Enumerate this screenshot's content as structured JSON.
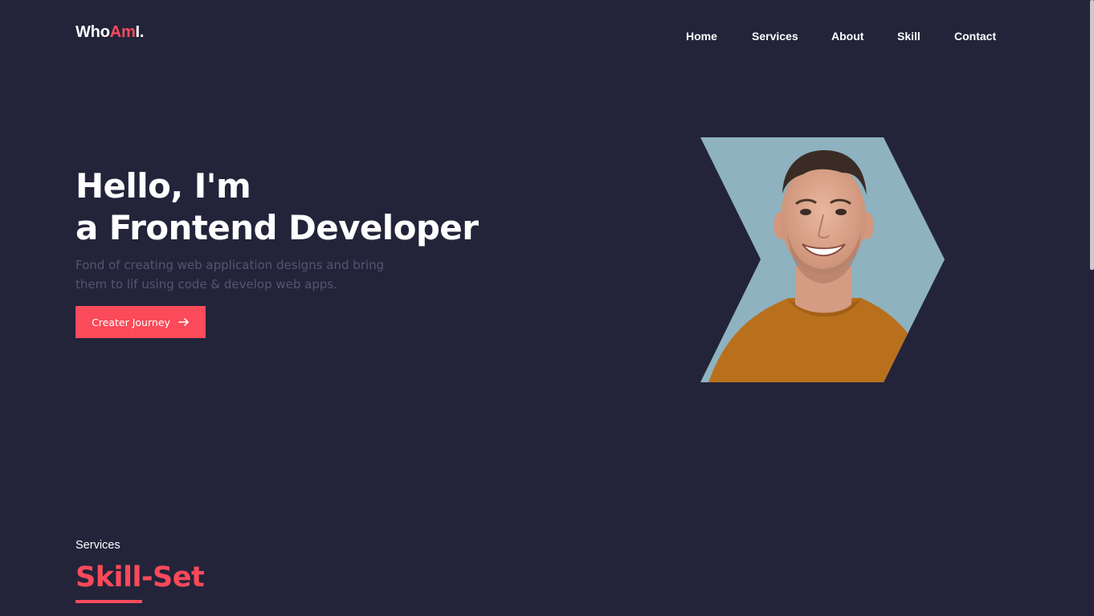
{
  "brand": {
    "part1": "Who",
    "part2": "Am",
    "part3": "I."
  },
  "nav": [
    {
      "label": "Home"
    },
    {
      "label": "Services"
    },
    {
      "label": "About"
    },
    {
      "label": "Skill"
    },
    {
      "label": "Contact"
    }
  ],
  "hero": {
    "title_line1": "Hello, I'm",
    "title_line2": "a Frontend Developer",
    "subtitle_line1": "Fond of creating web application designs and bring",
    "subtitle_line2": "them to lif using code & develop web apps.",
    "cta_label": "Creater Journey",
    "cta_icon": "arrow-right-icon",
    "portrait": "smiling-man-portrait"
  },
  "services": {
    "eyebrow": "Services",
    "title": "Skill-Set"
  },
  "colors": {
    "background": "#23243a",
    "accent": "#fb4a5a",
    "muted_text": "#545670",
    "portrait_backdrop": "#8eb2bf",
    "shirt": "#b9701d"
  }
}
